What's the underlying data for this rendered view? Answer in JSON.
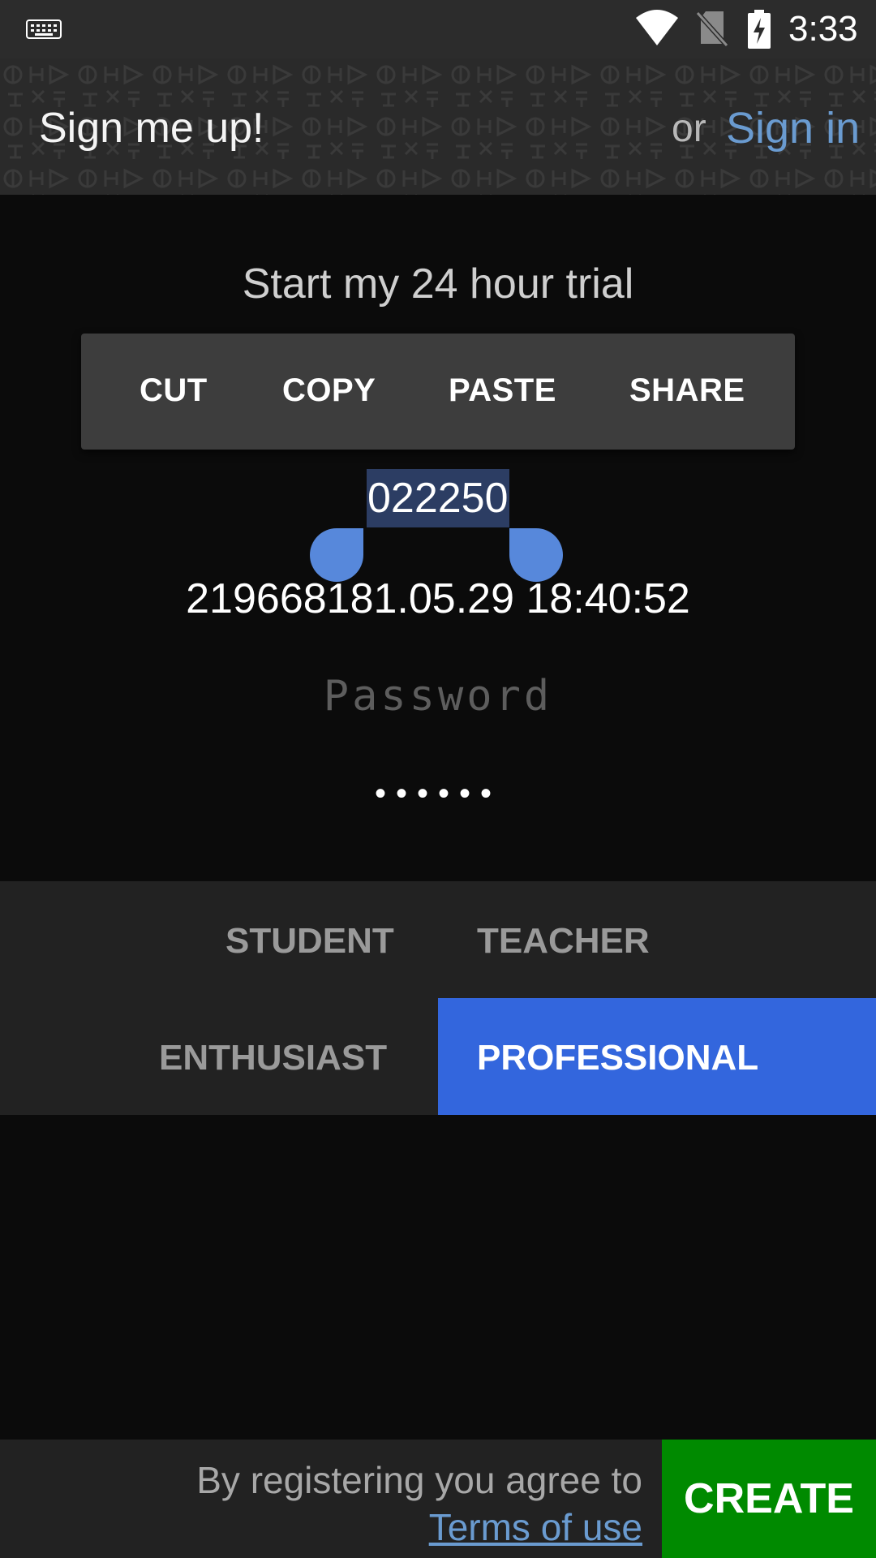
{
  "status_bar": {
    "time": "3:33",
    "icons": [
      "keyboard-icon",
      "wifi-icon",
      "no-sim-icon",
      "battery-charging-icon"
    ]
  },
  "header": {
    "title": "Sign me up!",
    "or_text": "or",
    "sign_in_label": "Sign in"
  },
  "main": {
    "trial_text": "Start my 24 hour trial",
    "context_menu": {
      "cut": "CUT",
      "copy": "COPY",
      "paste": "PASTE",
      "share": "SHARE"
    },
    "selected_code": "022250",
    "datetime_value": "219668181.05.29 18:40:52",
    "password_placeholder": "Password",
    "password_value": "••••••"
  },
  "roles": {
    "student": "STUDENT",
    "teacher": "TEACHER",
    "enthusiast": "ENTHUSIAST",
    "professional": "PROFESSIONAL",
    "selected": "PROFESSIONAL"
  },
  "footer": {
    "agree_text": "By registering you agree to",
    "terms_link": "Terms of use",
    "create_label": "CREATE"
  },
  "colors": {
    "accent_link": "#6a9bd0",
    "selected_role": "#3366dd",
    "create_button": "#008a00"
  }
}
